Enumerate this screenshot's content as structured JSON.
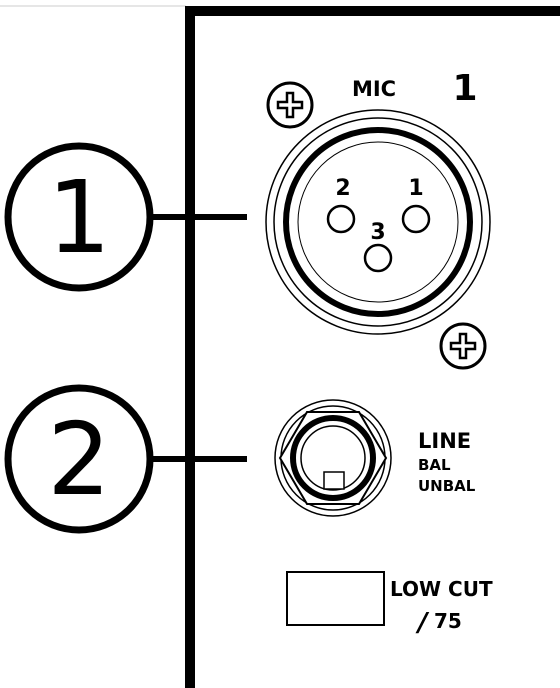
{
  "callouts": [
    {
      "number": "1"
    },
    {
      "number": "2"
    }
  ],
  "channel": {
    "number": "1"
  },
  "mic": {
    "label": "MIC",
    "pins": [
      "1",
      "2",
      "3"
    ]
  },
  "line": {
    "label": "LINE",
    "sub_labels": [
      "BAL",
      "UNBAL"
    ]
  },
  "low_cut": {
    "label": "LOW CUT",
    "value": "75",
    "slash_glyph": "/"
  },
  "icons": [
    "screw-icon",
    "xlr-connector-icon",
    "jack-connector-icon",
    "button-icon"
  ],
  "colors": {
    "line": "#000000",
    "background": "#ffffff"
  }
}
